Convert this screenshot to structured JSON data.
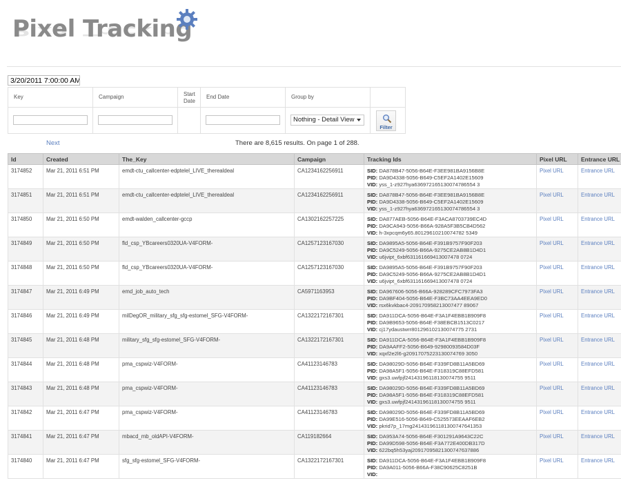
{
  "header": {
    "logo_text": "Pixel Tracking"
  },
  "filters": {
    "date_value": "3/20/2011 7:00:00 AM",
    "key_label": "Key",
    "campaign_label": "Campaign",
    "start_date_label": "Start\nDate",
    "start_line1": "Start",
    "start_line2": "Date",
    "end_date_label": "End Date",
    "group_by_label": "Group by",
    "group_by_value": "Nothing - Detail View",
    "filter_button": "Filter"
  },
  "pager": {
    "next": "Next",
    "results_text": "There are 8,615 results. On page 1 of 288."
  },
  "grid": {
    "columns": [
      "Id",
      "Created",
      "The_Key",
      "Campaign",
      "Tracking Ids",
      "Pixel URL",
      "Entrance URL"
    ],
    "sid_label": "SID:",
    "pid_label": "PID:",
    "vid_label": "VID:",
    "rows": [
      {
        "id": "3174852",
        "created": "Mar 21, 2011 6:51 PM",
        "key": "emdt-ctu_callcenter-edptelel_LIVE_therealdeal",
        "campaign": "CA1234162256911",
        "sid": "DA878B47-5056-B64E-F3EE981BA9156B8E",
        "pid": "DA9D4338-5056-B649-C5EF2A1402E15609",
        "vid": "yss_1-z927hya636972165130074786554 3",
        "pixel": "Pixel URL",
        "entrance": "Entrance URL"
      },
      {
        "id": "3174851",
        "created": "Mar 21, 2011 6:51 PM",
        "key": "emdt-ctu_callcenter-edptelel_LIVE_therealdeal",
        "campaign": "CA1234162256911",
        "sid": "DA878B47-5056-B64E-F3EE981BA9156B8E",
        "pid": "DA9D4338-5056-B649-C5EF2A1402E15609",
        "vid": "yss_1-z927hya636972165130074786554 3",
        "pixel": "Pixel URL",
        "entrance": "Entrance URL"
      },
      {
        "id": "3174850",
        "created": "Mar 21, 2011 6:50 PM",
        "key": "emdt-walden_callcenter-gccp",
        "campaign": "CA1302162257225",
        "sid": "DA877AEB-5056-B64E-F3ACA8703739EC4D",
        "pid": "DA9CA943-5056-B66A-928A5F3B5CB4D562",
        "vid": "h-3xpcqm6y65.80129610210074782 5349",
        "pixel": "Pixel URL",
        "entrance": "Entrance URL"
      },
      {
        "id": "3174849",
        "created": "Mar 21, 2011 6:50 PM",
        "key": "fld_csp_YBcareers0320UA-V4FORM-",
        "campaign": "CA1257123167030",
        "sid": "DA9895A5-5056-B64E-F391B9757F90F203",
        "pid": "DA9C5249-5056-B66A-9275CE2AB8B1D4D1",
        "vid": "u6jvipt_6xbf631161669413007478 0724",
        "pixel": "Pixel URL",
        "entrance": "Entrance URL"
      },
      {
        "id": "3174848",
        "created": "Mar 21, 2011 6:50 PM",
        "key": "fld_csp_YBcareers0320UA-V4FORM-",
        "campaign": "CA1257123167030",
        "sid": "DA9895A5-5056-B64E-F391B9757F90F203",
        "pid": "DA9C5249-5056-B66A-9275CE2AB8B1D4D1",
        "vid": "u6jvipt_6xbf631161669413007478 0724",
        "pixel": "Pixel URL",
        "entrance": "Entrance URL"
      },
      {
        "id": "3174847",
        "created": "Mar 21, 2011 6:49 PM",
        "key": "emd_job_auto_tech",
        "campaign": "CA5971163953",
        "sid": "DA967606-5056-B66A-928289CFC7973FA3",
        "pid": "DA9BF404-5056-B64E-F3BC73AA4EEA9ED0",
        "vid": "rsx6kvkbac4-209170958213007477 89067",
        "pixel": "Pixel URL",
        "entrance": "Entrance URL"
      },
      {
        "id": "3174846",
        "created": "Mar 21, 2011 6:49 PM",
        "key": "milDegOR_military_sfg_sfg-estomel_SFG-V4FORM-",
        "campaign": "CA1322172167301",
        "sid": "DA911DCA-5056-B64E-F3A1F4EBB1B909F8",
        "pid": "DA9B9653-5056-B64E-F38EBCB1513C0217",
        "vid": "cj17ydaustwrr801296102130074775 2731",
        "pixel": "Pixel URL",
        "entrance": "Entrance URL"
      },
      {
        "id": "3174845",
        "created": "Mar 21, 2011 6:48 PM",
        "key": "military_sfg_sfg-estomel_SFG-V4FORM-",
        "campaign": "CA1322172167301",
        "sid": "DA911DCA-5056-B64E-F3A1F4EBB1B909F8",
        "pid": "DA9AAFF2-5056-B649-92980093584D03F",
        "vid": "xqxf2e2l6-g20917075223130074769 3050",
        "pixel": "Pixel URL",
        "entrance": "Entrance URL"
      },
      {
        "id": "3174844",
        "created": "Mar 21, 2011 6:48 PM",
        "key": "pma_cspwiz-V4FORM-",
        "campaign": "CA41123146783",
        "sid": "DA98029D-5056-B64E-F339FD8B11A5BD69",
        "pid": "DA98A5F1-5056-B64E-F318319C88EFD581",
        "vid": "gxs3.uwfpjf24143196118130074755 9511",
        "pixel": "Pixel URL",
        "entrance": "Entrance URL"
      },
      {
        "id": "3174843",
        "created": "Mar 21, 2011 6:48 PM",
        "key": "pma_cspwiz-V4FORM-",
        "campaign": "CA41123146783",
        "sid": "DA98029D-5056-B64E-F339FD8B11A5BD69",
        "pid": "DA98A5F1-5056-B64E-F318319C88EFD581",
        "vid": "gxs3.uwfpjf24143196118130074755 9511",
        "pixel": "Pixel URL",
        "entrance": "Entrance URL"
      },
      {
        "id": "3174842",
        "created": "Mar 21, 2011 6:47 PM",
        "key": "pma_cspwiz-V4FORM-",
        "campaign": "CA41123146783",
        "sid": "DA98029D-5056-B64E-F339FD8B11A5BD69",
        "pid": "DA99E516-5056-B649-C525573EEAAF6EB2",
        "vid": "pkrid7p_17mg241431961181300747641353",
        "pixel": "Pixel URL",
        "entrance": "Entrance URL"
      },
      {
        "id": "3174841",
        "created": "Mar 21, 2011 6:47 PM",
        "key": "mbacd_mb_oldAPI-V4FORM-",
        "campaign": "CA119182664",
        "sid": "DA953A74-5056-B64E-F301291A9643C22C",
        "pid": "DA99D598-5056-B64E-F3A772E400DB317D",
        "vid": "622bq5h53yaj20917095821300747637886",
        "pixel": "Pixel URL",
        "entrance": "Entrance URL"
      },
      {
        "id": "3174840",
        "created": "Mar 21, 2011 6:47 PM",
        "key": "sfg_sfg-estomel_SFG-V4FORM-",
        "campaign": "CA1322172167301",
        "sid": "DA911DCA-5056-B64E-F3A1F4EBB1B909F8",
        "pid": "DA9A011-5056-B66A-F38C90625C8251B",
        "vid": "",
        "pixel": "Pixel URL",
        "entrance": "Entrance URL"
      }
    ]
  }
}
